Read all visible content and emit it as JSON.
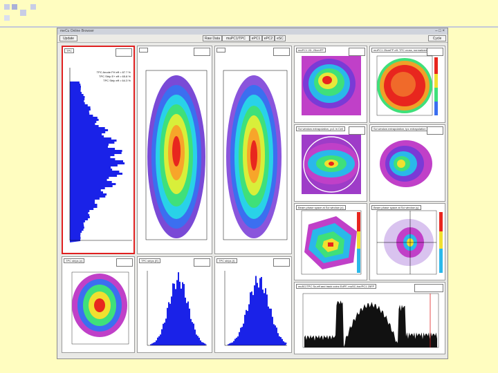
{
  "window": {
    "title": "meCu Online Browser",
    "controls": "– □ ×"
  },
  "menubar": {
    "left_button": "Update",
    "buttons": [
      "Raw Data",
      "muPC1/TPC",
      "ePC1",
      "ePC2",
      "eSC"
    ],
    "right_button": "Cycle"
  },
  "panels": {
    "hist1": {
      "title": "TPC",
      "legend": [
        "TPC Anode FH eff = 87.7 %",
        "TPC Strip E+ eff = 65.8 %",
        "TPC Strip eff = 64.3 %"
      ]
    },
    "title_muPC1_map": "muPC1 2D, 25cmFP",
    "title_muPC1_eff": "muPC1 25cmFP eff: TPC cross, normalized",
    "title_extrap_pc1": "Sci window extrapolation, pc1 in Cell",
    "title_extrap_tpc": "Sci window extrapolation, tpc extrapolation",
    "title_phase_1": "Beam phase space at Sci window (x)",
    "title_phase_2": "Beam phase space at Sci window (y)",
    "title_tpc_a": "TPC strips (x)",
    "title_tpc_b": "TPC strips (E)",
    "title_tpc_c": "TPC strips (t)",
    "title_sc": "muSC/TPC Sc-eff and track coinc EdFF, muSC-hor/PC1 25FP",
    "stats_label": "Entries"
  },
  "colors": {
    "accent_blue": "#1a22e8",
    "selection": "#e02020",
    "slide_bg": "#fffdc0"
  }
}
